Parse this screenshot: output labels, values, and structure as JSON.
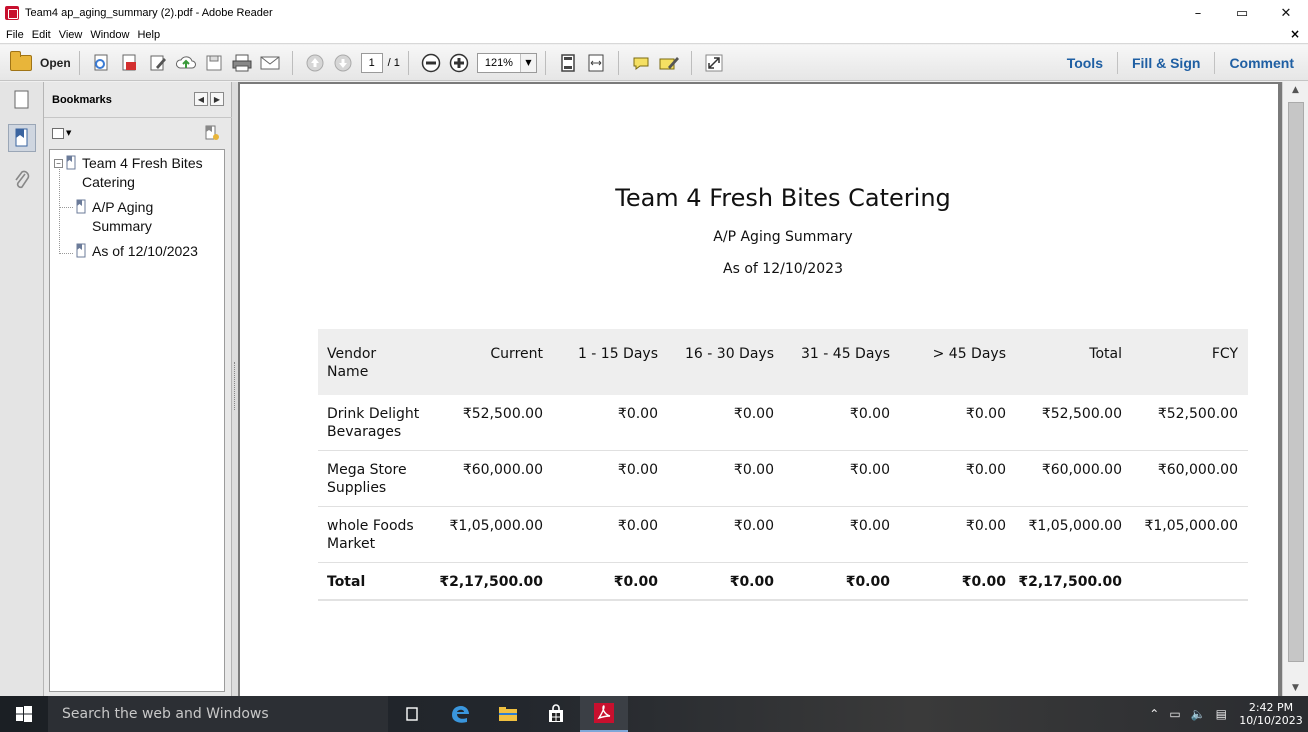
{
  "window": {
    "title": "Team4 ap_aging_summary (2).pdf - Adobe Reader",
    "minimize": "–",
    "maximize": "▭",
    "close": "✕"
  },
  "menu": {
    "items": [
      "File",
      "Edit",
      "View",
      "Window",
      "Help"
    ],
    "close_doc": "×"
  },
  "toolbar": {
    "open_label": "Open",
    "page_current": "1",
    "page_total": "/ 1",
    "zoom": "121%",
    "tools_label": "Tools",
    "fill_sign_label": "Fill & Sign",
    "comment_label": "Comment"
  },
  "bookmarks": {
    "title": "Bookmarks",
    "items": [
      {
        "label": "Team 4 Fresh Bites Catering",
        "level": 0
      },
      {
        "label": "A/P Aging Summary",
        "level": 1
      },
      {
        "label": "As of 12/10/2023",
        "level": 1
      }
    ]
  },
  "document": {
    "company": "Team 4 Fresh Bites Catering",
    "report_name": "A/P Aging Summary",
    "as_of": "As of 12/10/2023",
    "table": {
      "headers": [
        "Vendor Name",
        "Current",
        "1 - 15 Days",
        "16 - 30 Days",
        "31 - 45 Days",
        "> 45 Days",
        "Total",
        "FCY"
      ],
      "rows": [
        [
          "Drink Delight Bevarages",
          "₹52,500.00",
          "₹0.00",
          "₹0.00",
          "₹0.00",
          "₹0.00",
          "₹52,500.00",
          "₹52,500.00"
        ],
        [
          "Mega Store Supplies",
          "₹60,000.00",
          "₹0.00",
          "₹0.00",
          "₹0.00",
          "₹0.00",
          "₹60,000.00",
          "₹60,000.00"
        ],
        [
          "whole Foods Market",
          "₹1,05,000.00",
          "₹0.00",
          "₹0.00",
          "₹0.00",
          "₹0.00",
          "₹1,05,000.00",
          "₹1,05,000.00"
        ]
      ],
      "total": [
        "Total",
        "₹2,17,500.00",
        "₹0.00",
        "₹0.00",
        "₹0.00",
        "₹0.00",
        "₹2,17,500.00",
        ""
      ]
    }
  },
  "taskbar": {
    "search_placeholder": "Search the web and Windows",
    "time": "2:42 PM",
    "date": "10/10/2023"
  },
  "colors": {
    "accent_link": "#1f5fa3",
    "acrobat_red": "#c8102e",
    "table_header_bg": "#eeeeee"
  }
}
